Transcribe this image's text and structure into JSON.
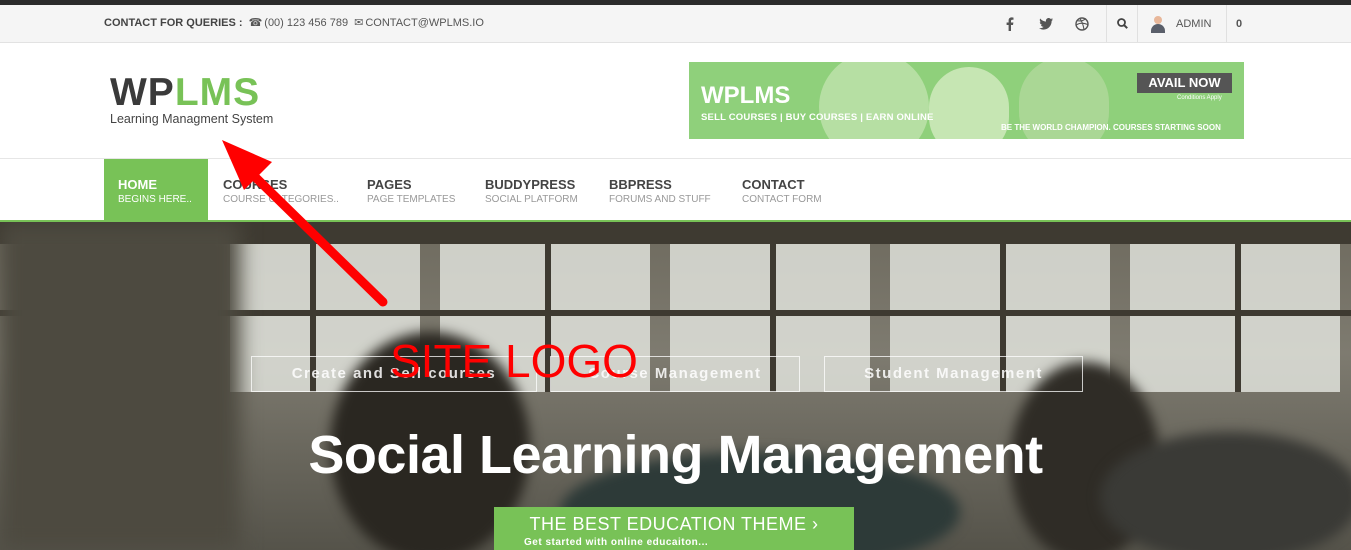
{
  "topbar": {
    "contact_label": "CONTACT FOR QUERIES :",
    "phone": "(00) 123 456 789",
    "email": "CONTACT@WPLMS.IO",
    "social_icons": [
      "facebook-icon",
      "twitter-icon",
      "dribbble-icon"
    ],
    "user_label": "ADMIN",
    "cart_count": "0"
  },
  "header": {
    "logo_wp": "WP",
    "logo_lms": "LMS",
    "tagline": "Learning Managment System",
    "banner": {
      "brand": "WPLMS",
      "subtext": "SELL COURSES | BUY COURSES | EARN ONLINE",
      "button": "AVAIL NOW",
      "conditions": "Conditions Apply",
      "slogan": "BE THE WORLD CHAMPION. COURSES STARTING SOON"
    }
  },
  "nav": {
    "items": [
      {
        "title": "HOME",
        "subtitle": "BEGINS HERE..",
        "active": true
      },
      {
        "title": "COURSES",
        "subtitle": "COURSE CATEGORIES..",
        "active": false
      },
      {
        "title": "PAGES",
        "subtitle": "PAGE TEMPLATES",
        "active": false
      },
      {
        "title": "BUDDYPRESS",
        "subtitle": "SOCIAL PLATFORM",
        "active": false
      },
      {
        "title": "BBPRESS",
        "subtitle": "FORUMS AND STUFF",
        "active": false
      },
      {
        "title": "CONTACT",
        "subtitle": "CONTACT FORM",
        "active": false
      }
    ]
  },
  "hero": {
    "captions": [
      "Create and Sell courses",
      "Course Management",
      "Student Management"
    ],
    "title": "Social Learning Management",
    "cta_title": "THE BEST EDUCATION THEME ›",
    "cta_sub": "Get started with online educaiton..."
  },
  "annotation": {
    "label": "SITE LOGO",
    "color": "#ff0000"
  },
  "colors": {
    "accent": "#78c257",
    "dark": "#3a3a3a"
  }
}
